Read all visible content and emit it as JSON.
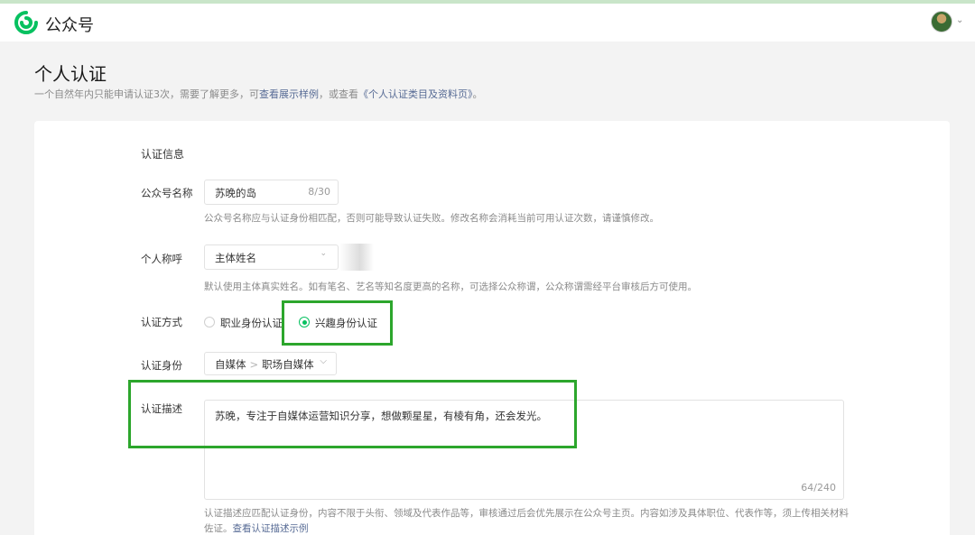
{
  "header": {
    "brand": "公众号",
    "logo_icon": "weixin-mp-logo",
    "avatar_caret": "⌄"
  },
  "page": {
    "title": "个人认证",
    "desc_prefix": "一个自然年内只能申请认证3次，需要了解更多，可",
    "desc_link1": "查看展示样例",
    "desc_mid": "，或查看",
    "desc_link2": "《个人认证类目及资料页》",
    "desc_suffix": "。"
  },
  "form": {
    "section_title": "认证信息",
    "name": {
      "label": "公众号名称",
      "value": "苏晚的岛",
      "counter": "8/30",
      "hint": "公众号名称应与认证身份相匹配，否则可能导致认证失败。修改名称会消耗当前可用认证次数，请谨慎修改。"
    },
    "title": {
      "label": "个人称呼",
      "value": "主体姓名",
      "hint": "默认使用主体真实姓名。如有笔名、艺名等知名度更高的名称，可选择公众称谓，公众称谓需经平台审核后方可使用。"
    },
    "method": {
      "label": "认证方式",
      "options": [
        "职业身份认证",
        "兴趣身份认证"
      ],
      "selected": "兴趣身份认证"
    },
    "identity": {
      "label": "认证身份",
      "level1": "自媒体",
      "level2": "职场自媒体"
    },
    "description": {
      "label": "认证描述",
      "value": "苏晚，专注于自媒体运营知识分享，想做颗星星，有棱有角，还会发光。",
      "counter": "64/240",
      "hint": "认证描述应匹配认证身份，内容不限于头衔、领域及代表作品等，审核通过后会优先展示在公众号主页。内容如涉及具体职位、代表作等，须上传相关材料佐证。",
      "hint_link": "查看认证描述示例"
    }
  },
  "colors": {
    "accent": "#07c160",
    "highlight": "#2ca62c",
    "link": "#576b95"
  }
}
